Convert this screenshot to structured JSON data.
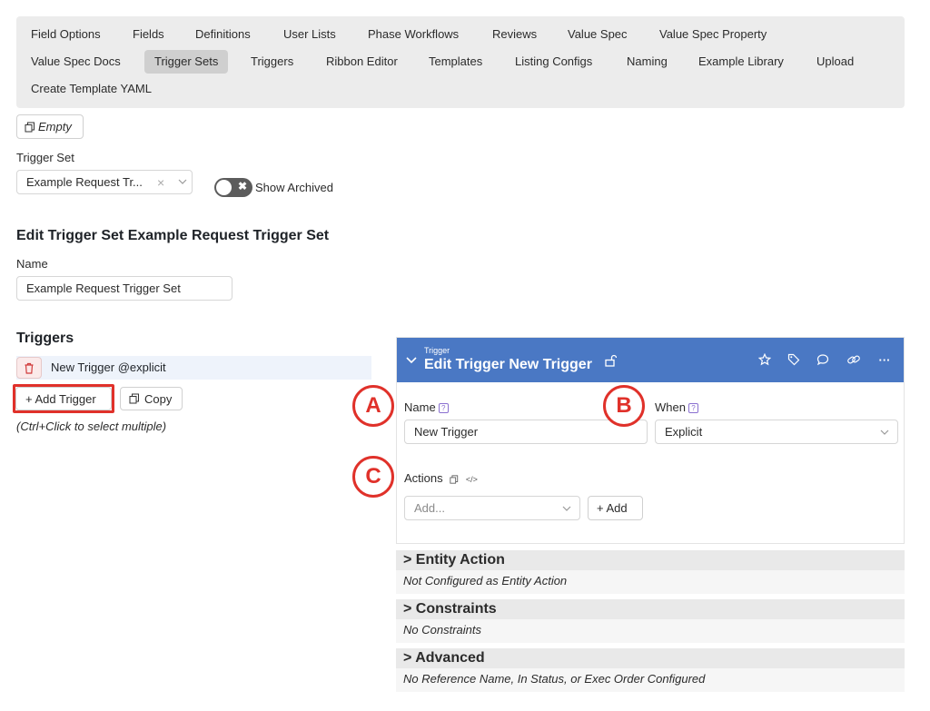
{
  "nav": {
    "items": [
      "Field Options",
      "Fields",
      "Definitions",
      "User Lists",
      "Phase Workflows",
      "Reviews",
      "Value Spec",
      "Value Spec Property",
      "Value Spec Docs",
      "Trigger Sets",
      "Triggers",
      "Ribbon Editor",
      "Templates",
      "Listing Configs",
      "Naming",
      "Example Library",
      "Upload",
      "Create Template YAML"
    ],
    "active": "Trigger Sets"
  },
  "empty_button": "Empty",
  "trigger_set": {
    "label": "Trigger Set",
    "selected": "Example Request Tr...",
    "show_archived": "Show Archived"
  },
  "edit": {
    "heading": "Edit Trigger Set Example Request Trigger Set",
    "name_label": "Name",
    "name_value": "Example Request Trigger Set"
  },
  "triggers": {
    "heading": "Triggers",
    "items": [
      "New Trigger @explicit"
    ],
    "add_button": "+ Add Trigger",
    "copy_button": "Copy",
    "hint": "(Ctrl+Click to select multiple)"
  },
  "panel": {
    "small_label": "Trigger",
    "title": "Edit Trigger New Trigger",
    "name_label": "Name",
    "name_value": "New Trigger",
    "when_label": "When",
    "when_value": "Explicit",
    "actions_label": "Actions",
    "actions_placeholder": "Add...",
    "add_button": "+ Add",
    "help_glyph": "?"
  },
  "badges": {
    "a": "A",
    "b": "B",
    "c": "C"
  },
  "sections": [
    {
      "title": "Entity Action",
      "subtitle": "Not Configured as Entity Action"
    },
    {
      "title": "Constraints",
      "subtitle": "No Constraints"
    },
    {
      "title": "Advanced",
      "subtitle": "No Reference Name, In Status, or Exec Order Configured"
    }
  ],
  "colors": {
    "header_blue": "#4a78c4",
    "annotation_red": "#e0312a",
    "help_purple": "#8a70d0"
  }
}
